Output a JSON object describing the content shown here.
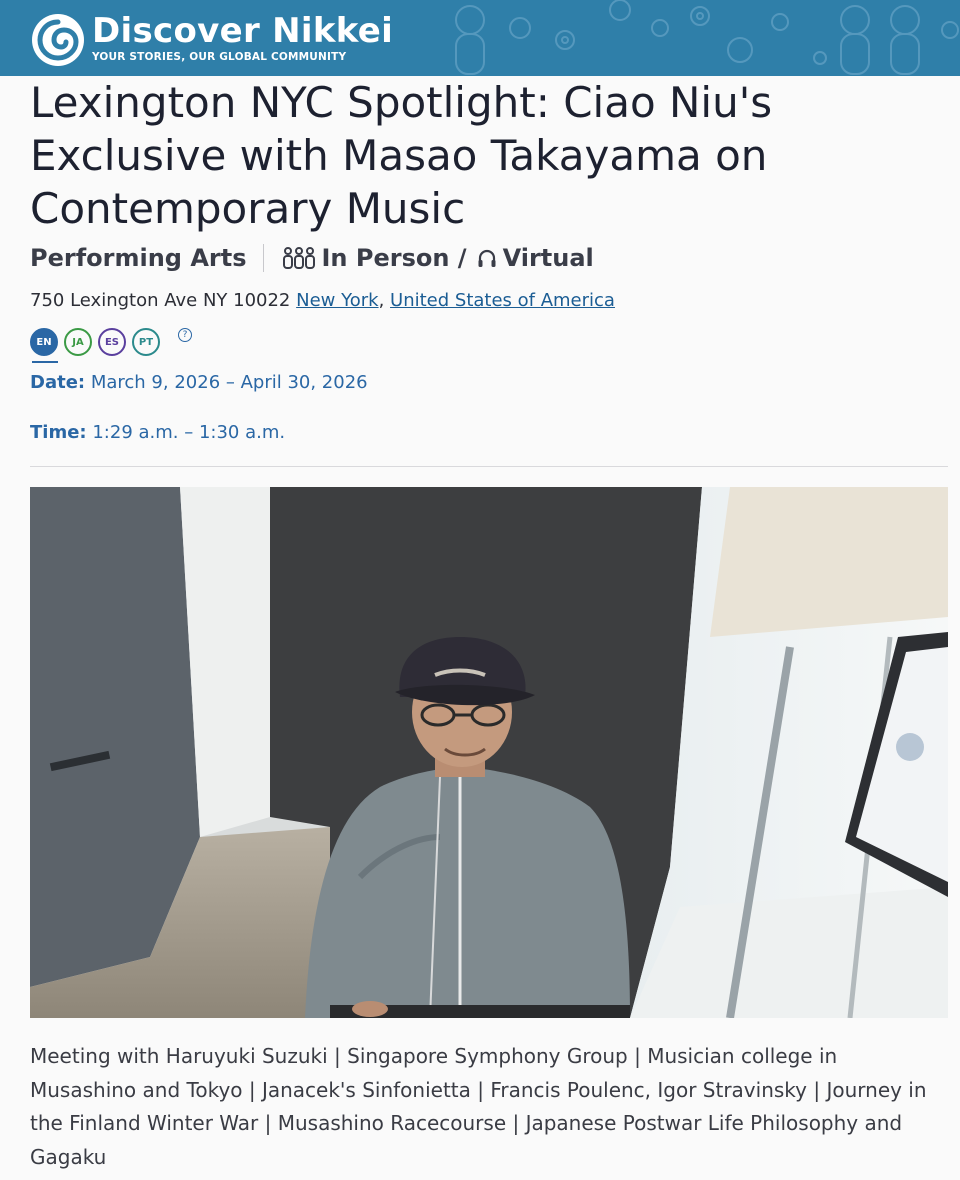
{
  "header": {
    "brand_title": "Discover Nikkei",
    "brand_tagline": "YOUR STORIES, OUR GLOBAL COMMUNITY",
    "logo_icon": "discover-nikkei-swirl-logo",
    "background_color": "#2f7fa9"
  },
  "event": {
    "title": "Lexington NYC Spotlight: Ciao Niu's Exclusive with Masao Takayama on Contemporary Music",
    "category": "Performing Arts",
    "in_person_label": "In Person /",
    "virtual_label": "Virtual",
    "in_person_icon": "people-icon",
    "virtual_icon": "headphones-icon",
    "address_text": "750 Lexington Ave NY 10022",
    "city_link": "New York",
    "address_comma": ",",
    "country_link": "United States of America",
    "languages": [
      {
        "code": "EN",
        "active": true,
        "color": "#2a67a5"
      },
      {
        "code": "JA",
        "active": false,
        "color": "#3b9a45"
      },
      {
        "code": "ES",
        "active": false,
        "color": "#5a3f9e"
      },
      {
        "code": "PT",
        "active": false,
        "color": "#2b8a8c"
      }
    ],
    "help_symbol": "?",
    "date_label": "Date:",
    "date_value": "March 9, 2026 – April 30, 2026",
    "time_label": "Time:",
    "time_value": "1:29 a.m. – 1:30 a.m.",
    "caption": "Meeting with Haruyuki Suzuki | Singapore Symphony Group | Musician college in Musashino and Tokyo | Janacek's Sinfonietta | Francis Poulenc, Igor Stravinsky | Journey in the Finland Winter War | Musashino Racecourse | Japanese Postwar Life Philosophy and Gagaku"
  },
  "colors": {
    "accent": "#2a67a5",
    "link": "#1b5d94",
    "title": "#1d2130"
  }
}
